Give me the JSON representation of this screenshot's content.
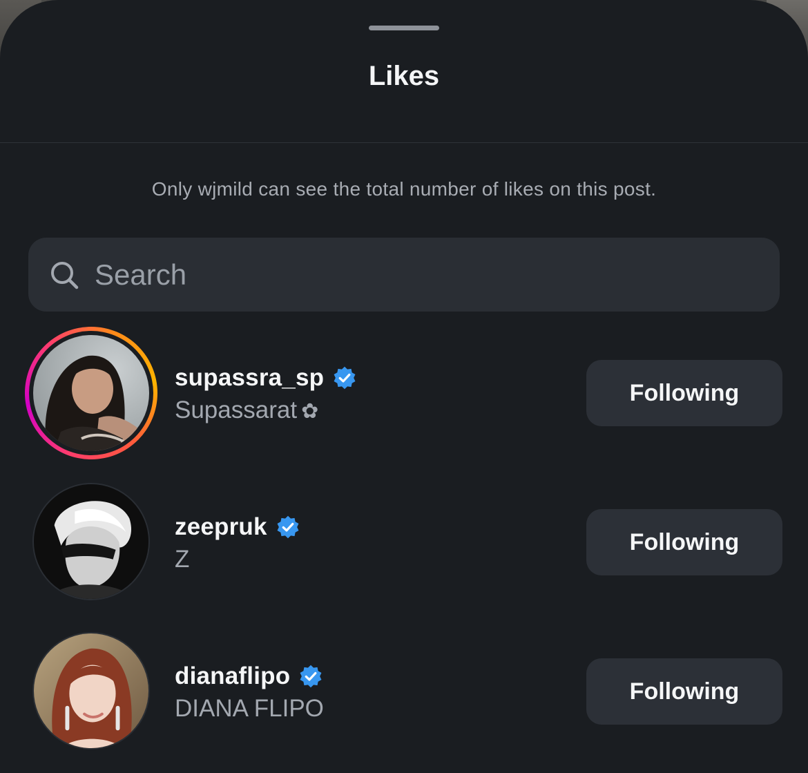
{
  "sheet": {
    "title": "Likes",
    "notice": "Only wjmild can see the total number of likes on this post."
  },
  "search": {
    "placeholder": "Search"
  },
  "users": [
    {
      "username": "supassra_sp",
      "full_name": "Supassarat",
      "name_suffix": "✿",
      "verified": true,
      "has_story_ring": true,
      "button_label": "Following"
    },
    {
      "username": "zeepruk",
      "full_name": "Z",
      "name_suffix": "",
      "verified": true,
      "has_story_ring": false,
      "button_label": "Following"
    },
    {
      "username": "dianaflipo",
      "full_name": "DIANA FLIPO",
      "name_suffix": "",
      "verified": true,
      "has_story_ring": false,
      "button_label": "Following"
    }
  ],
  "colors": {
    "background": "#1a1d21",
    "verified_badge": "#3897f0",
    "button_bg": "#2c3037",
    "story_ring_gradient": [
      "#d300c5",
      "#ff3d6c",
      "#ffb400"
    ]
  },
  "icons": {
    "search": "search-icon",
    "verified": "verified-badge-icon",
    "grabber": "drag-handle"
  }
}
